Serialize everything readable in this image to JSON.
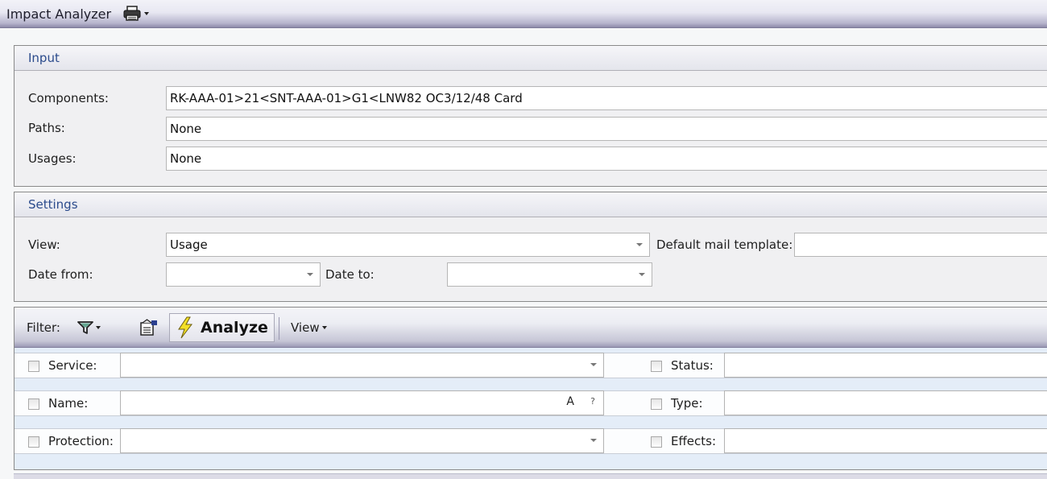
{
  "window": {
    "title": "Impact Analyzer",
    "print_icon": "printer-icon"
  },
  "input": {
    "header": "Input",
    "components_label": "Components:",
    "components_value": "RK-AAA-01>21<SNT-AAA-01>G1<LNW82 OC3/12/48 Card",
    "paths_label": "Paths:",
    "paths_value": "None",
    "usages_label": "Usages:",
    "usages_value": "None"
  },
  "settings": {
    "header": "Settings",
    "view_label": "View:",
    "view_value": "Usage",
    "date_from_label": "Date from:",
    "date_from_value": "",
    "date_to_label": "Date to:",
    "date_to_value": "",
    "mail_template_label": "Default mail template:",
    "mail_template_value": ""
  },
  "filter": {
    "toolbar": {
      "filter_label": "Filter:",
      "filter_icon": "funnel-icon",
      "properties_icon": "properties-icon",
      "analyze_label": "Analyze",
      "analyze_icon": "lightning-icon",
      "view_label": "View"
    },
    "fields": {
      "service_label": "Service:",
      "service_value": "",
      "name_label": "Name:",
      "name_value": "",
      "name_case_glyph": "A",
      "name_help_glyph": "?",
      "protection_label": "Protection:",
      "protection_value": "",
      "status_label": "Status:",
      "status_value": "",
      "type_label": "Type:",
      "type_value": "",
      "effects_label": "Effects:",
      "effects_value": ""
    },
    "checked": {
      "service": false,
      "name": false,
      "protection": false,
      "status": false,
      "type": false,
      "effects": false
    }
  }
}
